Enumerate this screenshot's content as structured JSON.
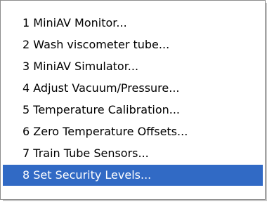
{
  "menu": {
    "items": [
      {
        "label": "1 MiniAV Monitor..."
      },
      {
        "label": "2 Wash viscometer tube..."
      },
      {
        "label": "3 MiniAV Simulator..."
      },
      {
        "label": "4 Adjust Vacuum/Pressure..."
      },
      {
        "label": "5 Temperature Calibration..."
      },
      {
        "label": "6 Zero Temperature Offsets..."
      },
      {
        "label": "7 Train Tube Sensors..."
      },
      {
        "label": "8 Set Security Levels..."
      }
    ],
    "selected_index": 7,
    "highlight_color": "#316ac5"
  }
}
